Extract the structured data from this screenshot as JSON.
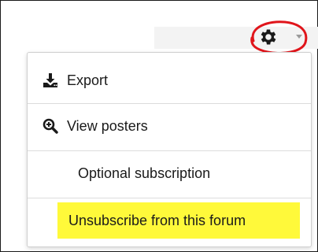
{
  "menu": {
    "items": [
      {
        "label": "Export",
        "icon": "download-icon"
      },
      {
        "label": "View posters",
        "icon": "zoom-in-icon"
      },
      {
        "label": "Optional subscription",
        "icon": ""
      },
      {
        "label": "Unsubscribe from this forum",
        "icon": "",
        "highlight": "#fff93a"
      }
    ]
  },
  "toolbar": {
    "icon": "gear-icon"
  },
  "colors": {
    "highlight_ring": "#e0151b",
    "highlight_fill": "#fff93a"
  }
}
